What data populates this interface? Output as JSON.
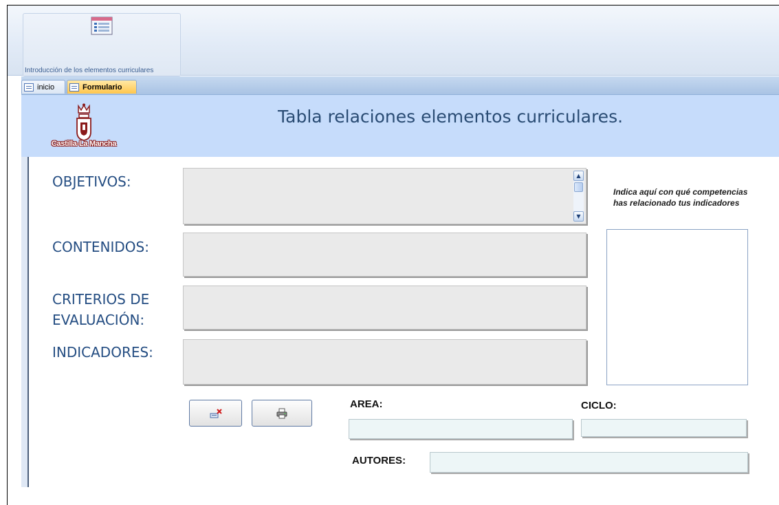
{
  "ribbon": {
    "group_label": "Introducción de los elementos curriculares",
    "group_icon": "form-list-icon"
  },
  "tabs": [
    {
      "label": "inicio",
      "icon": "form-icon",
      "active": false
    },
    {
      "label": "Formulario",
      "icon": "form-icon",
      "active": true
    }
  ],
  "header": {
    "title": "Tabla relaciones elementos curriculares.",
    "logo_text": "Castilla-La Mancha",
    "background": "#c6dcfb"
  },
  "fields": {
    "objetivos": {
      "label": "OBJETIVOS:",
      "value": ""
    },
    "contenidos": {
      "label": "CONTENIDOS:",
      "value": ""
    },
    "criterios": {
      "label": "CRITERIOS DE EVALUACIÓN:",
      "value": ""
    },
    "indicadores": {
      "label": "INDICADORES:",
      "value": ""
    }
  },
  "competencias": {
    "hint": "Indica aquí con qué competencias has relacionado tus indicadores",
    "value": ""
  },
  "buttons": {
    "delete_icon": "delete-record-icon",
    "print_icon": "print-icon"
  },
  "bottom": {
    "area_label": "AREA:",
    "area_value": "",
    "ciclo_label": "CICLO:",
    "ciclo_value": "",
    "autores_label": "AUTORES:",
    "autores_value": ""
  },
  "colors": {
    "label_blue": "#244d82",
    "title_blue": "#2a4c74",
    "active_tab": "#ffc64d"
  }
}
